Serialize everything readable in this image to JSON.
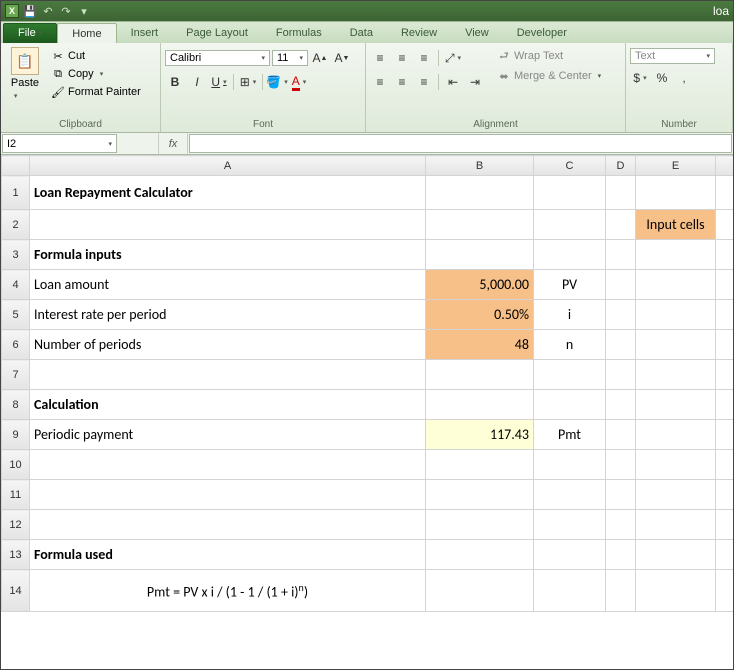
{
  "titlebar": {
    "doc": "loa",
    "app_icon": "X"
  },
  "tabs": {
    "file": "File",
    "items": [
      "Home",
      "Insert",
      "Page Layout",
      "Formulas",
      "Data",
      "Review",
      "View",
      "Developer"
    ],
    "active": "Home"
  },
  "ribbon": {
    "clipboard": {
      "paste": "Paste",
      "cut": "Cut",
      "copy": "Copy",
      "painter": "Format Painter",
      "label": "Clipboard"
    },
    "font": {
      "name": "Calibri",
      "size": "11",
      "label": "Font",
      "b": "B",
      "i": "I",
      "u": "U"
    },
    "alignment": {
      "label": "Alignment",
      "wrap": "Wrap Text",
      "merge": "Merge & Center"
    },
    "number": {
      "label": "Number",
      "fmt": "Text",
      "cur": "$",
      "pct": "%",
      "comma": ","
    }
  },
  "fbar": {
    "name": "I2",
    "fx": "fx",
    "value": ""
  },
  "cols": [
    "A",
    "B",
    "C",
    "D",
    "E"
  ],
  "rows": [
    "1",
    "2",
    "3",
    "4",
    "5",
    "6",
    "7",
    "8",
    "9",
    "10",
    "11",
    "12",
    "13",
    "14"
  ],
  "cells": {
    "A1": "Loan Repayment Calculator",
    "E2": "Input cells",
    "A3": "Formula inputs",
    "A4": "Loan amount",
    "B4": "5,000.00",
    "C4": "PV",
    "A5": "Interest rate per period",
    "B5": "0.50%",
    "C5": "i",
    "A6": "Number of periods",
    "B6": "48",
    "C6": "n",
    "A8": "Calculation",
    "A9": "Periodic payment",
    "B9": "117.43",
    "C9": "Pmt",
    "A13": "Formula used",
    "A14_before": "Pmt = PV x i /  (1 - 1 / (1 + i)",
    "A14_sup": "n",
    "A14_after": ")"
  }
}
